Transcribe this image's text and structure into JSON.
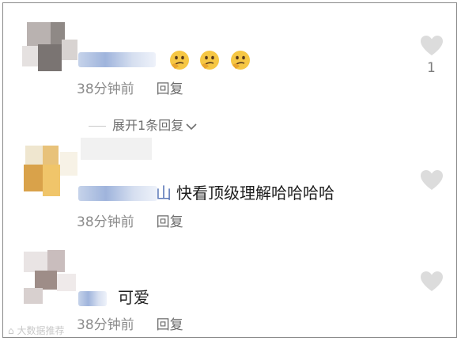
{
  "comments": [
    {
      "name_visible": "",
      "text": "",
      "emojis": [
        "thinking-face-emoji",
        "thinking-face-emoji",
        "thinking-face-emoji"
      ],
      "time": "38分钟前",
      "reply": "回复",
      "likes": "1",
      "replies_toggle": "展开1条回复"
    },
    {
      "name_visible": "山",
      "text": "快看顶级理解哈哈哈哈",
      "time": "38分钟前",
      "reply": "回复",
      "likes": ""
    },
    {
      "name_visible": "",
      "text": "可爱",
      "time": "38分钟前",
      "reply": "回复",
      "likes": ""
    }
  ],
  "watermark": "大数据推荐",
  "colors": {
    "meta_text": "#8b8b8b",
    "heart": "#dcdcdc",
    "link_name": "#5b78b8"
  }
}
